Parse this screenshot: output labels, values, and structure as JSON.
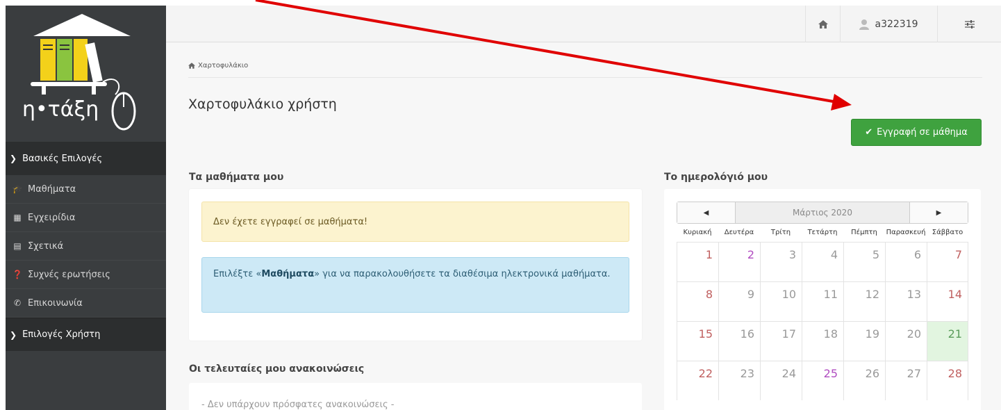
{
  "logo": {
    "text": "η•τάξη"
  },
  "sidebar": {
    "section_basic": "Βασικές Επιλογές",
    "items": [
      {
        "label": "Μαθήματα",
        "icon": "graduation-cap-icon"
      },
      {
        "label": "Εγχειρίδια",
        "icon": "document-icon"
      },
      {
        "label": "Σχετικά",
        "icon": "card-icon"
      },
      {
        "label": "Συχνές ερωτήσεις",
        "icon": "question-circle-icon"
      },
      {
        "label": "Επικοινωνία",
        "icon": "phone-icon"
      }
    ],
    "section_user": "Επιλογές Χρήστη"
  },
  "topbar": {
    "username": "a322319"
  },
  "breadcrumb": {
    "label": "Χαρτοφυλάκιο"
  },
  "page": {
    "title": "Χαρτοφυλάκιο χρήστη",
    "enroll_button": "Εγγραφή σε μάθημα"
  },
  "courses": {
    "heading": "Τα μαθήματα μου",
    "warning": "Δεν έχετε εγγραφεί σε μαθήματα!",
    "info_prefix": "Επιλέξτε «",
    "info_bold": "Μαθήματα",
    "info_suffix": "» για να παρακολουθήσετε τα διαθέσιμα ηλεκτρονικά μαθήματα."
  },
  "announcements": {
    "heading": "Οι τελευταίες μου ανακοινώσεις",
    "empty": "- Δεν υπάρχουν πρόσφατες ανακοινώσεις -"
  },
  "calendar": {
    "heading": "Το ημερολόγιό μου",
    "month": "Μάρτιος 2020",
    "days_of_week": [
      "Κυριακή",
      "Δευτέρα",
      "Τρίτη",
      "Τετάρτη",
      "Πέμπτη",
      "Παρασκευή",
      "Σάββατο"
    ],
    "weeks": [
      [
        "1",
        "2",
        "3",
        "4",
        "5",
        "6",
        "7"
      ],
      [
        "8",
        "9",
        "10",
        "11",
        "12",
        "13",
        "14"
      ],
      [
        "15",
        "16",
        "17",
        "18",
        "19",
        "20",
        "21"
      ],
      [
        "22",
        "23",
        "24",
        "25",
        "26",
        "27",
        "28"
      ]
    ],
    "event_days": [
      "2",
      "25"
    ],
    "today": "21"
  },
  "colors": {
    "sidebar_bg": "#3a3d3f",
    "enroll_green": "#3fa23f",
    "arrow_red": "#e00000"
  }
}
